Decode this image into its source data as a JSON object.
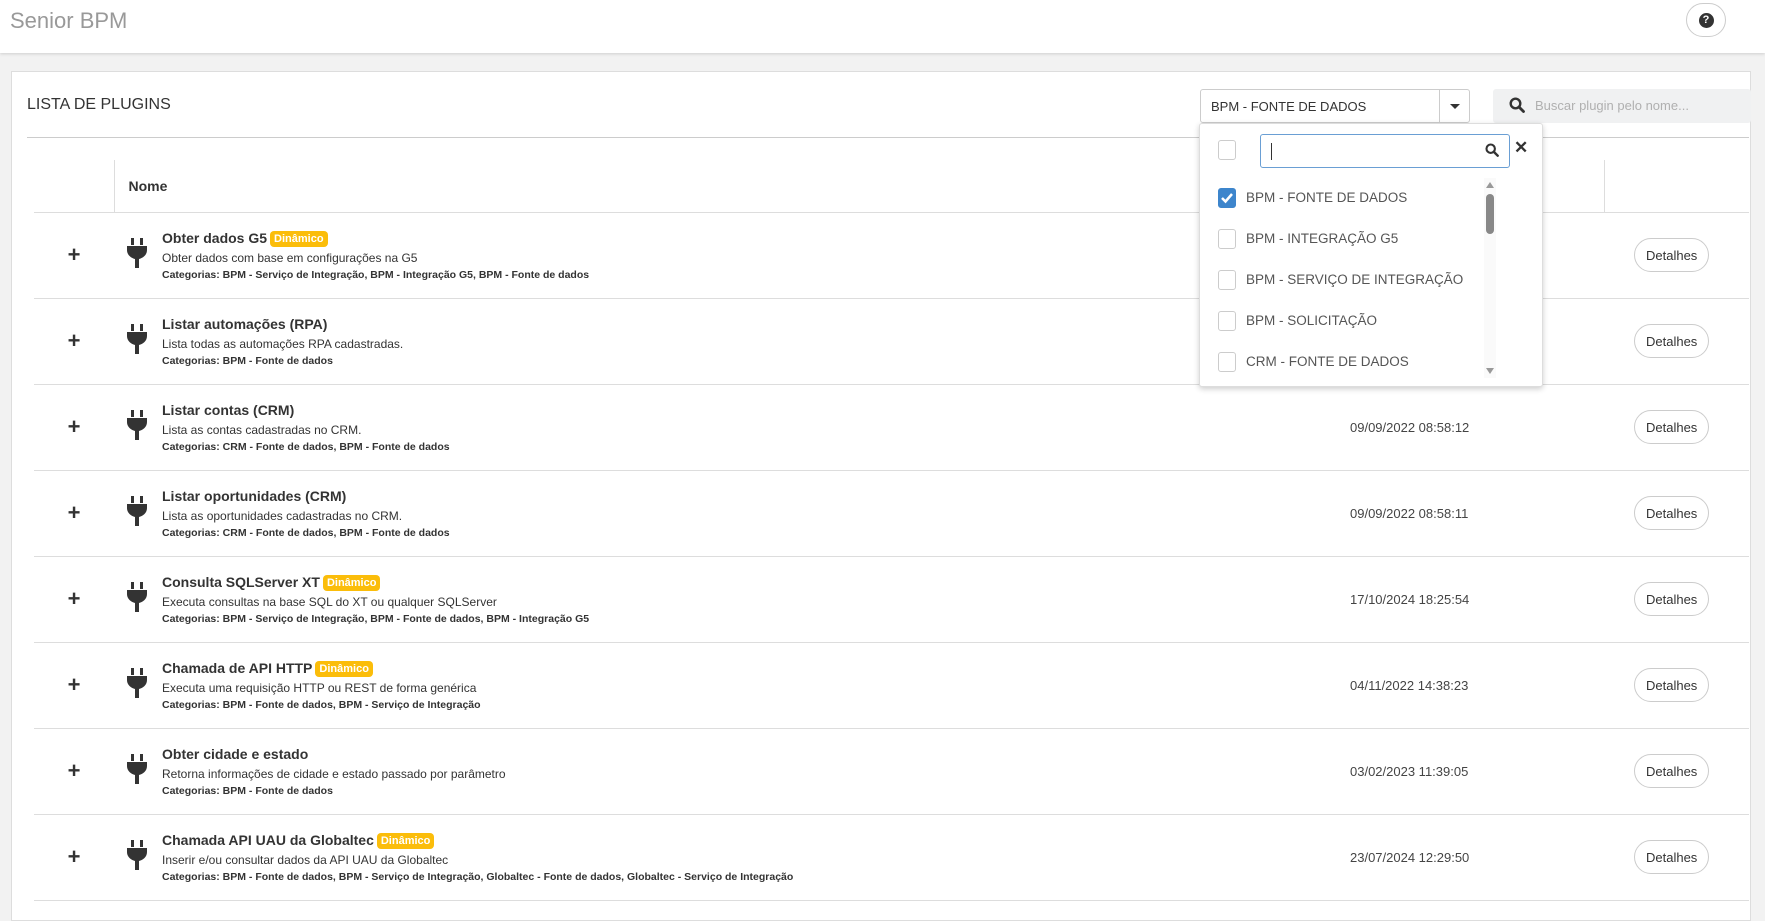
{
  "header": {
    "app_title": "Senior BPM",
    "help_icon": "question-circle-icon"
  },
  "card": {
    "title": "LISTA DE PLUGINS"
  },
  "filter": {
    "selected": "BPM - FONTE DE DADOS",
    "search_placeholder": "Buscar plugin pelo nome...",
    "options": [
      {
        "label": "BPM - FONTE DE DADOS",
        "checked": true
      },
      {
        "label": "BPM - INTEGRAÇÃO G5",
        "checked": false
      },
      {
        "label": "BPM - SERVIÇO DE INTEGRAÇÃO",
        "checked": false
      },
      {
        "label": "BPM - SOLICITAÇÃO",
        "checked": false
      },
      {
        "label": "CRM - FONTE DE DADOS",
        "checked": false
      }
    ]
  },
  "table": {
    "col_name": "Nome",
    "details_label": "Detalhes",
    "expand_label": "+",
    "rows": [
      {
        "name": "Obter dados G5",
        "badge": "Dinâmico",
        "desc": "Obter dados com base em configurações na G5",
        "cat": "Categorias: BPM - Serviço de Integração, BPM - Integração G5, BPM - Fonte de dados",
        "date": ""
      },
      {
        "name": "Listar automações (RPA)",
        "badge": "",
        "desc": "Lista todas as automações RPA cadastradas.",
        "cat": "Categorias: BPM - Fonte de dados",
        "date": ""
      },
      {
        "name": "Listar contas (CRM)",
        "badge": "",
        "desc": "Lista as contas cadastradas no CRM.",
        "cat": "Categorias: CRM - Fonte de dados, BPM - Fonte de dados",
        "date": "09/09/2022 08:58:12"
      },
      {
        "name": "Listar oportunidades (CRM)",
        "badge": "",
        "desc": "Lista as oportunidades cadastradas no CRM.",
        "cat": "Categorias: CRM - Fonte de dados, BPM - Fonte de dados",
        "date": "09/09/2022 08:58:11"
      },
      {
        "name": "Consulta SQLServer XT",
        "badge": "Dinâmico",
        "desc": "Executa consultas na base SQL do XT ou qualquer SQLServer",
        "cat": "Categorias: BPM - Serviço de Integração, BPM - Fonte de dados, BPM - Integração G5",
        "date": "17/10/2024 18:25:54"
      },
      {
        "name": "Chamada de API HTTP",
        "badge": "Dinâmico",
        "desc": "Executa uma requisição HTTP ou REST de forma genérica",
        "cat": "Categorias: BPM - Fonte de dados, BPM - Serviço de Integração",
        "date": "04/11/2022 14:38:23"
      },
      {
        "name": "Obter cidade e estado",
        "badge": "",
        "desc": "Retorna informações de cidade e estado passado por parâmetro",
        "cat": "Categorias: BPM - Fonte de dados",
        "date": "03/02/2023 11:39:05"
      },
      {
        "name": "Chamada API UAU da Globaltec",
        "badge": "Dinâmico",
        "desc": "Inserir e/ou consultar dados da API UAU da Globaltec",
        "cat": "Categorias: BPM - Fonte de dados, BPM - Serviço de Integração, Globaltec - Fonte de dados, Globaltec - Serviço de Integração",
        "date": "23/07/2024 12:29:50"
      }
    ]
  },
  "colors": {
    "badge": "#fbbd0a",
    "checkbox_checked": "#3d85cc"
  }
}
